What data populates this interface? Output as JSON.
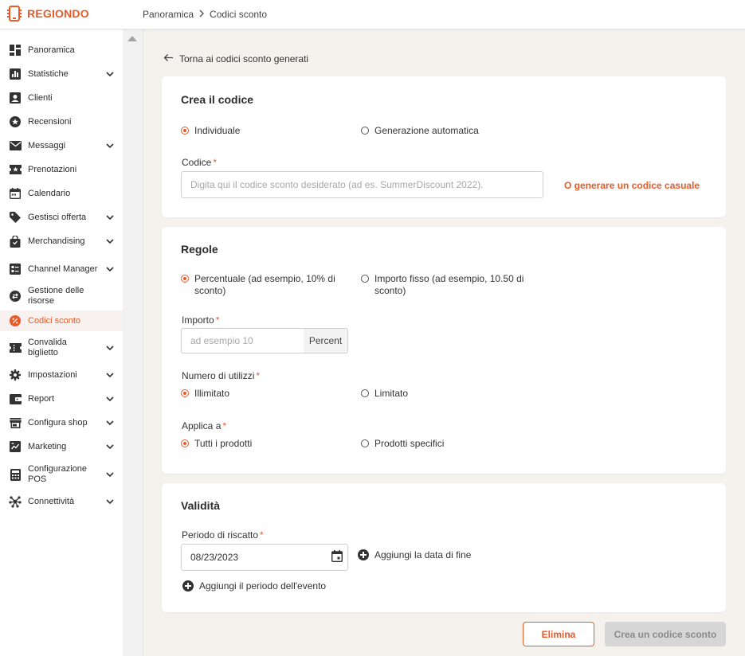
{
  "app": {
    "brand": "REGIONDO",
    "accent": "#e85a2a"
  },
  "breadcrumb": {
    "items": [
      "Panoramica",
      "Codici sconto"
    ]
  },
  "sidebar": {
    "items": [
      {
        "label": "Panoramica",
        "icon": "dashboard-icon",
        "chevron": false
      },
      {
        "label": "Statistiche",
        "icon": "bar-chart-icon",
        "chevron": true
      },
      {
        "label": "Clienti",
        "icon": "person-card-icon",
        "chevron": false
      },
      {
        "label": "Recensioni",
        "icon": "star-circle-icon",
        "chevron": false
      },
      {
        "label": "Messaggi",
        "icon": "envelope-icon",
        "chevron": true
      },
      {
        "label": "Prenotazioni",
        "icon": "star-ticket-icon",
        "chevron": false
      },
      {
        "label": "Calendario",
        "icon": "calendar-icon",
        "chevron": false
      },
      {
        "label": "Gestisci offerta",
        "icon": "tag-icon",
        "chevron": true
      },
      {
        "label": "Merchandising",
        "icon": "shopping-bag-icon",
        "chevron": true
      },
      {
        "label": "Channel Manager",
        "icon": "channel-icon",
        "chevron": true
      },
      {
        "label": "Gestione delle risorse",
        "icon": "swap-circle-icon",
        "chevron": false
      },
      {
        "label": "Codici sconto",
        "icon": "percent-circle-icon",
        "chevron": false,
        "active": true
      },
      {
        "label": "Convalida biglietto",
        "icon": "ticket-icon",
        "chevron": true
      },
      {
        "label": "Impostazioni",
        "icon": "gear-icon",
        "chevron": true
      },
      {
        "label": "Report",
        "icon": "wallet-icon",
        "chevron": true
      },
      {
        "label": "Configura shop",
        "icon": "store-icon",
        "chevron": true
      },
      {
        "label": "Marketing",
        "icon": "marketing-icon",
        "chevron": true
      },
      {
        "label": "Configurazione POS",
        "icon": "calculator-icon",
        "chevron": true
      },
      {
        "label": "Connettività",
        "icon": "hub-icon",
        "chevron": true
      }
    ]
  },
  "main": {
    "back_label": "Torna ai codici sconto generati",
    "create": {
      "title": "Crea il codice",
      "options": [
        "Individuale",
        "Generazione automatica"
      ],
      "selected": 0,
      "code_label": "Codice",
      "code_placeholder": "Digita qui il codice sconto desiderato (ad es. SummerDiscount 2022).",
      "code_value": "",
      "random_link": "O generare un codice casuale"
    },
    "rules": {
      "title": "Regole",
      "type_options": [
        "Percentuale (ad esempio, 10% di sconto)",
        "Importo fisso (ad esempio, 10.50 di sconto)"
      ],
      "type_selected": 0,
      "amount_label": "Importo",
      "amount_placeholder": "ad esempio 10",
      "amount_value": "",
      "amount_unit": "Percent",
      "usage_label": "Numero di utilizzi",
      "usage_options": [
        "Illimitato",
        "Limitato"
      ],
      "usage_selected": 0,
      "apply_label": "Applica a",
      "apply_options": [
        "Tutti i prodotti",
        "Prodotti specifici"
      ],
      "apply_selected": 0
    },
    "validity": {
      "title": "Validità",
      "period_label": "Periodo di riscatto",
      "date_value": "08/23/2023",
      "add_end_date": "Aggiungi la data di fine",
      "add_event_period": "Aggiungi il periodo dell'evento"
    },
    "actions": {
      "delete_label": "Elimina",
      "create_label": "Crea un codice sconto"
    }
  }
}
